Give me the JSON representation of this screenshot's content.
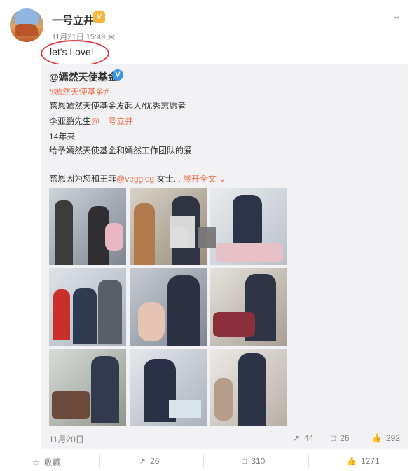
{
  "post": {
    "username": "一号立井",
    "vip_badge": "V",
    "time": "11月21日 15:49 来",
    "text": "let's Love!",
    "menu_icon": "chevron-down-icon"
  },
  "repost": {
    "author": "@嫣然天使基金",
    "verified_icon": "V",
    "hashtag": "#嫣然天使基金#",
    "line1": "感恩嫣然天使基金发起人/优秀志愿者",
    "line2_prefix": "李亚鹏先生",
    "line2_mention": "@一号立井",
    "line3": "14年来",
    "line4": "给予嫣然天使基金和嫣然工作团队的爱",
    "line5_prefix": "感恩因为您和王菲",
    "line5_mention": "@veggieg",
    "line5_suffix": " 女士... ",
    "expand_label": "展开全文 ⌄",
    "date": "11月20日",
    "repost_count": "44",
    "comment_count": "26",
    "like_count": "292"
  },
  "actions": {
    "favorite_label": "收藏",
    "repost_count": "26",
    "comment_count": "310",
    "like_count": "1271"
  },
  "colors": {
    "link": "#eb7350",
    "highlight": "#e23b3b",
    "repost_bg": "#f2f2f5"
  }
}
